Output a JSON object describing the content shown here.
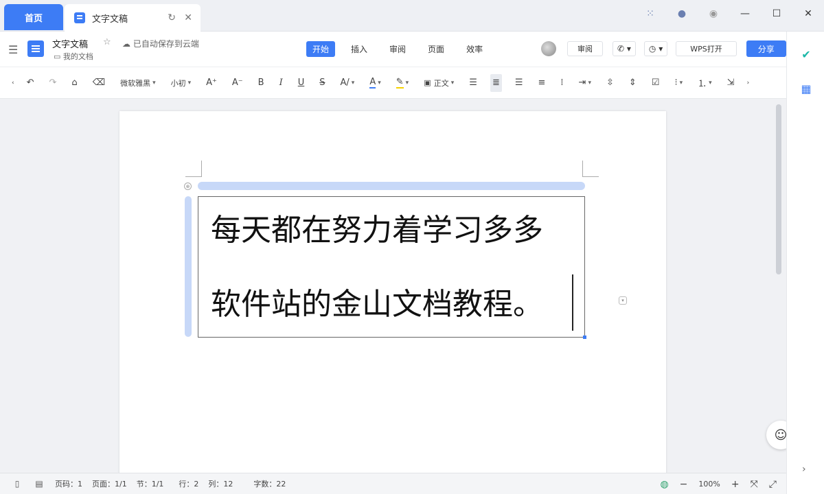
{
  "titlebar": {
    "home_tab": "首页",
    "doc_tab": "文字文稿"
  },
  "header": {
    "title": "文字文稿",
    "saved": "已自动保存到云端",
    "folder": "我的文档",
    "menus": [
      "开始",
      "插入",
      "审阅",
      "页面",
      "效率"
    ],
    "active_menu": "开始",
    "review_btn": "审阅",
    "wps_btn": "WPS打开",
    "share_btn": "分享"
  },
  "toolbar": {
    "font_name": "微软雅黑",
    "font_size": "小初",
    "style": "正文"
  },
  "document": {
    "lines": [
      "每天都在努力着学习多多",
      "软件站的金山文档教程。"
    ]
  },
  "status": {
    "page_num": "页码：1",
    "pages": "页面：1/1",
    "section": "节：1/1",
    "row": "行：2",
    "col": "列：12",
    "words": "字数：22",
    "zoom": "100%"
  }
}
